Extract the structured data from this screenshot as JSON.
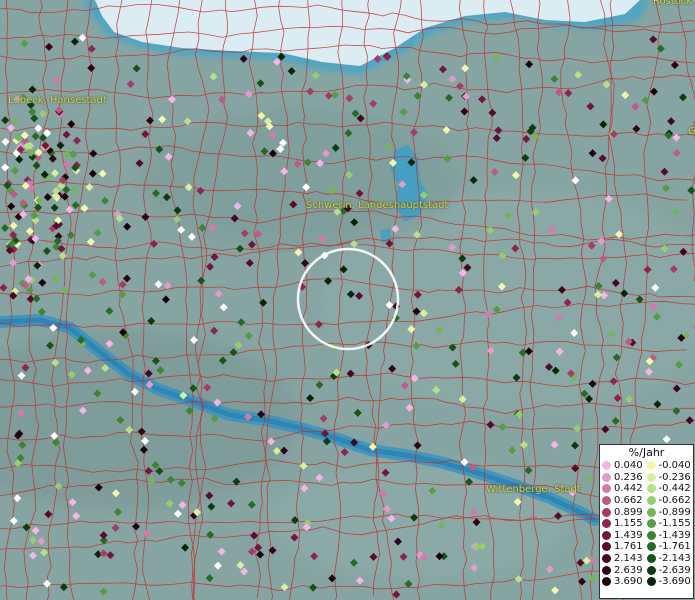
{
  "map": {
    "city_labels": [
      {
        "id": "rostock",
        "text": "Rostock"
      },
      {
        "id": "luebeck",
        "text": "Lübeck, Hansestadt"
      },
      {
        "id": "schwerin",
        "text": "Schwerin, Landeshauptstadt"
      },
      {
        "id": "wittenberge",
        "text": "Wittenberge, Stadt"
      },
      {
        "id": "g-edge",
        "text": "G"
      }
    ]
  },
  "legend": {
    "title": "%/Jahr",
    "positive": [
      {
        "value": "0.040",
        "color": "#f4b6e6"
      },
      {
        "value": "0.236",
        "color": "#e49acb"
      },
      {
        "value": "0.442",
        "color": "#d27aa9"
      },
      {
        "value": "0.662",
        "color": "#bd5a88"
      },
      {
        "value": "0.899",
        "color": "#a53c68"
      },
      {
        "value": "1.155",
        "color": "#8c2550"
      },
      {
        "value": "1.439",
        "color": "#73153b"
      },
      {
        "value": "1.761",
        "color": "#5a0b2b"
      },
      {
        "value": "2.143",
        "color": "#430620"
      },
      {
        "value": "2.639",
        "color": "#2e0416"
      },
      {
        "value": "3.690",
        "color": "#1c020c"
      }
    ],
    "negative": [
      {
        "value": "-0.040",
        "color": "#f2f7b0"
      },
      {
        "value": "-0.236",
        "color": "#d6efa0"
      },
      {
        "value": "-0.442",
        "color": "#b8e08a"
      },
      {
        "value": "-0.662",
        "color": "#96cc72"
      },
      {
        "value": "-0.899",
        "color": "#74b55c"
      },
      {
        "value": "-1.155",
        "color": "#559c46"
      },
      {
        "value": "-1.439",
        "color": "#3c8334"
      },
      {
        "value": "-1.761",
        "color": "#276a25"
      },
      {
        "value": "-2.143",
        "color": "#175219"
      },
      {
        "value": "-2.639",
        "color": "#0c3c10"
      },
      {
        "value": "-3.690",
        "color": "#052607"
      }
    ]
  }
}
